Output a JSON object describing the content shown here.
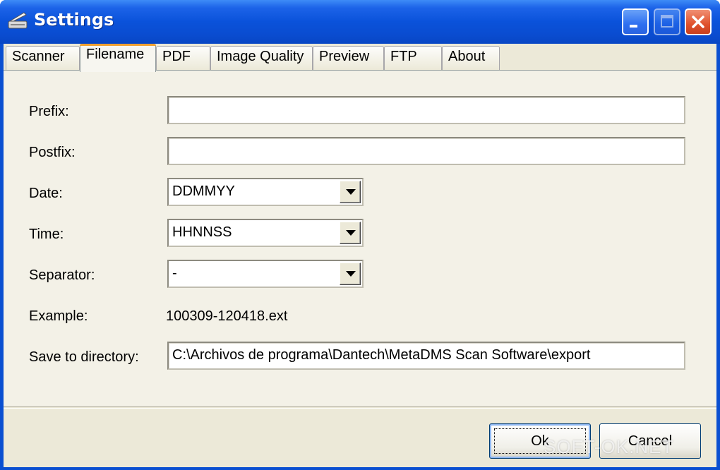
{
  "window": {
    "title": "Settings",
    "title_bar_color": "#0a52da",
    "controls": {
      "minimize": "minimize-icon",
      "maximize": "maximize-icon",
      "close": "close-icon"
    }
  },
  "tabs": [
    {
      "label": "Scanner"
    },
    {
      "label": "Filename",
      "active": true
    },
    {
      "label": "PDF"
    },
    {
      "label": "Image Quality"
    },
    {
      "label": "Preview"
    },
    {
      "label": "FTP"
    },
    {
      "label": "About"
    }
  ],
  "form": {
    "prefix": {
      "label": "Prefix:",
      "value": ""
    },
    "postfix": {
      "label": "Postfix:",
      "value": ""
    },
    "date": {
      "label": "Date:",
      "selected": "DDMMYY"
    },
    "time": {
      "label": "Time:",
      "selected": "HHNNSS"
    },
    "separator": {
      "label": "Separator:",
      "selected": "-"
    },
    "example": {
      "label": "Example:",
      "value": "100309-120418.ext"
    },
    "directory": {
      "label": "Save to directory:",
      "value": "C:\\Archivos de programa\\Dantech\\MetaDMS Scan Software\\export"
    }
  },
  "buttons": {
    "ok": "Ok",
    "cancel": "Cancel"
  },
  "watermark": "SOFT-OK.NET"
}
